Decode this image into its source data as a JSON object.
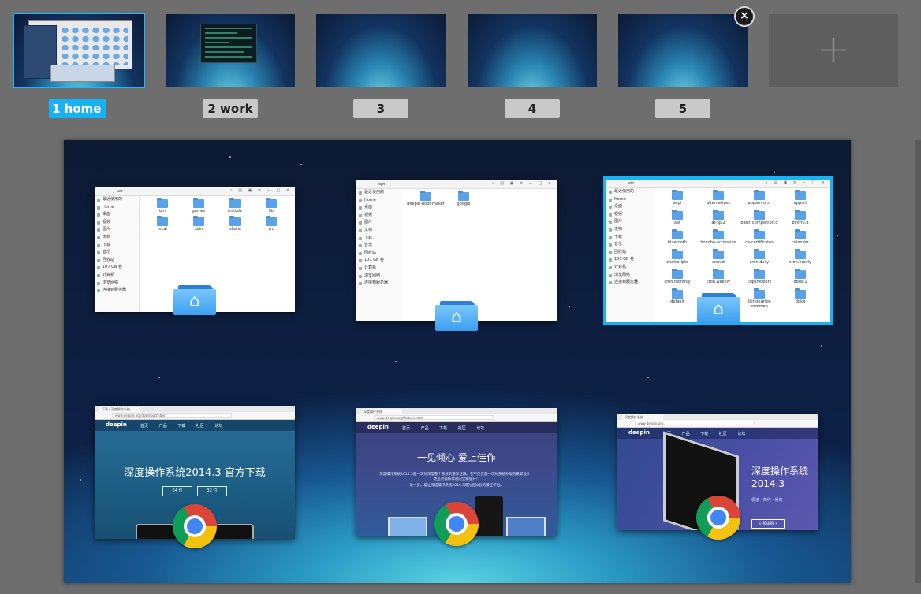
{
  "workspaces": [
    {
      "label": "1 home",
      "active": true
    },
    {
      "label": "2 work",
      "active": false
    },
    {
      "label": "3",
      "active": false
    },
    {
      "label": "4",
      "active": false
    },
    {
      "label": "5",
      "active": false
    }
  ],
  "close_icon": "×",
  "add_icon": "+",
  "file_managers": [
    {
      "path": "usr",
      "sidebar": [
        "最近使用的",
        "Home",
        "桌面",
        "视频",
        "图片",
        "文档",
        "下载",
        "音乐",
        "回收站",
        "107 GB 卷",
        "计算机",
        "浏览网络",
        "连接到服务器"
      ],
      "items": [
        "bin",
        "games",
        "include",
        "lib",
        "local",
        "sbin",
        "share",
        "src"
      ]
    },
    {
      "path": "opt",
      "sidebar": [
        "最近使用的",
        "Home",
        "桌面",
        "视频",
        "图片",
        "文档",
        "下载",
        "音乐",
        "回收站",
        "107 GB 卷",
        "计算机",
        "浏览网络",
        "连接到服务器"
      ],
      "items": [
        "deepin-boot-maker",
        "google"
      ]
    },
    {
      "path": "etc",
      "sidebar": [
        "最近使用的",
        "Home",
        "桌面",
        "视频",
        "图片",
        "文档",
        "下载",
        "音乐",
        "回收站",
        "107 GB 卷",
        "计算机",
        "浏览网络",
        "连接到服务器"
      ],
      "items": [
        "acpi",
        "alternatives",
        "apparmor.d",
        "apport",
        "apt",
        "at-spi2",
        "bash_completion.d",
        "binfmt.d",
        "bluetooth",
        "bonobo-activation",
        "ca-certificates",
        "calendar",
        "chatscripts",
        "cron.d",
        "cron.daily",
        "cron.hourly",
        "cron.monthly",
        "cron.weekly",
        "cupshelpers",
        "dbus-1",
        "default",
        "",
        "dictionaries-common",
        "dpkg"
      ]
    }
  ],
  "browsers": [
    {
      "tab": "下载 | 深度操作系统",
      "url": "www.deepin.org/download.html",
      "logo": "deepin",
      "nav": "首页 产品 下载 社区 论坛",
      "headline": "深度操作系统2014.3 官方下载",
      "btn1": "64 位",
      "btn2": "32 位"
    },
    {
      "tab": "深度操作系统",
      "url": "www.deepin.org/feature.html",
      "logo": "deepin",
      "nav": "首页 产品 下载 社区 论坛",
      "headline": "一见倾心 爱上佳作",
      "body": "深度操作系统2014.3是一次对深度整个系统的重新诠释。它不仅仅是一次对系统外观的重新设计，更是对操作体验的全新提升！",
      "body2": "进一步，着让深度操作系统2014.3成为您体验的最佳伴侣。"
    },
    {
      "tab": "深度操作系统",
      "url": "www.deepin.org",
      "logo": "deepin",
      "nav": "首页 产品 下载 社区 论坛",
      "headline": "深度操作系统",
      "version": "2014.3",
      "tagline": "极速 · 简约 · 易用",
      "cta": "立即体验 »"
    }
  ],
  "colors": {
    "accent": "#17b2f4",
    "background": "#6e6e6e"
  }
}
